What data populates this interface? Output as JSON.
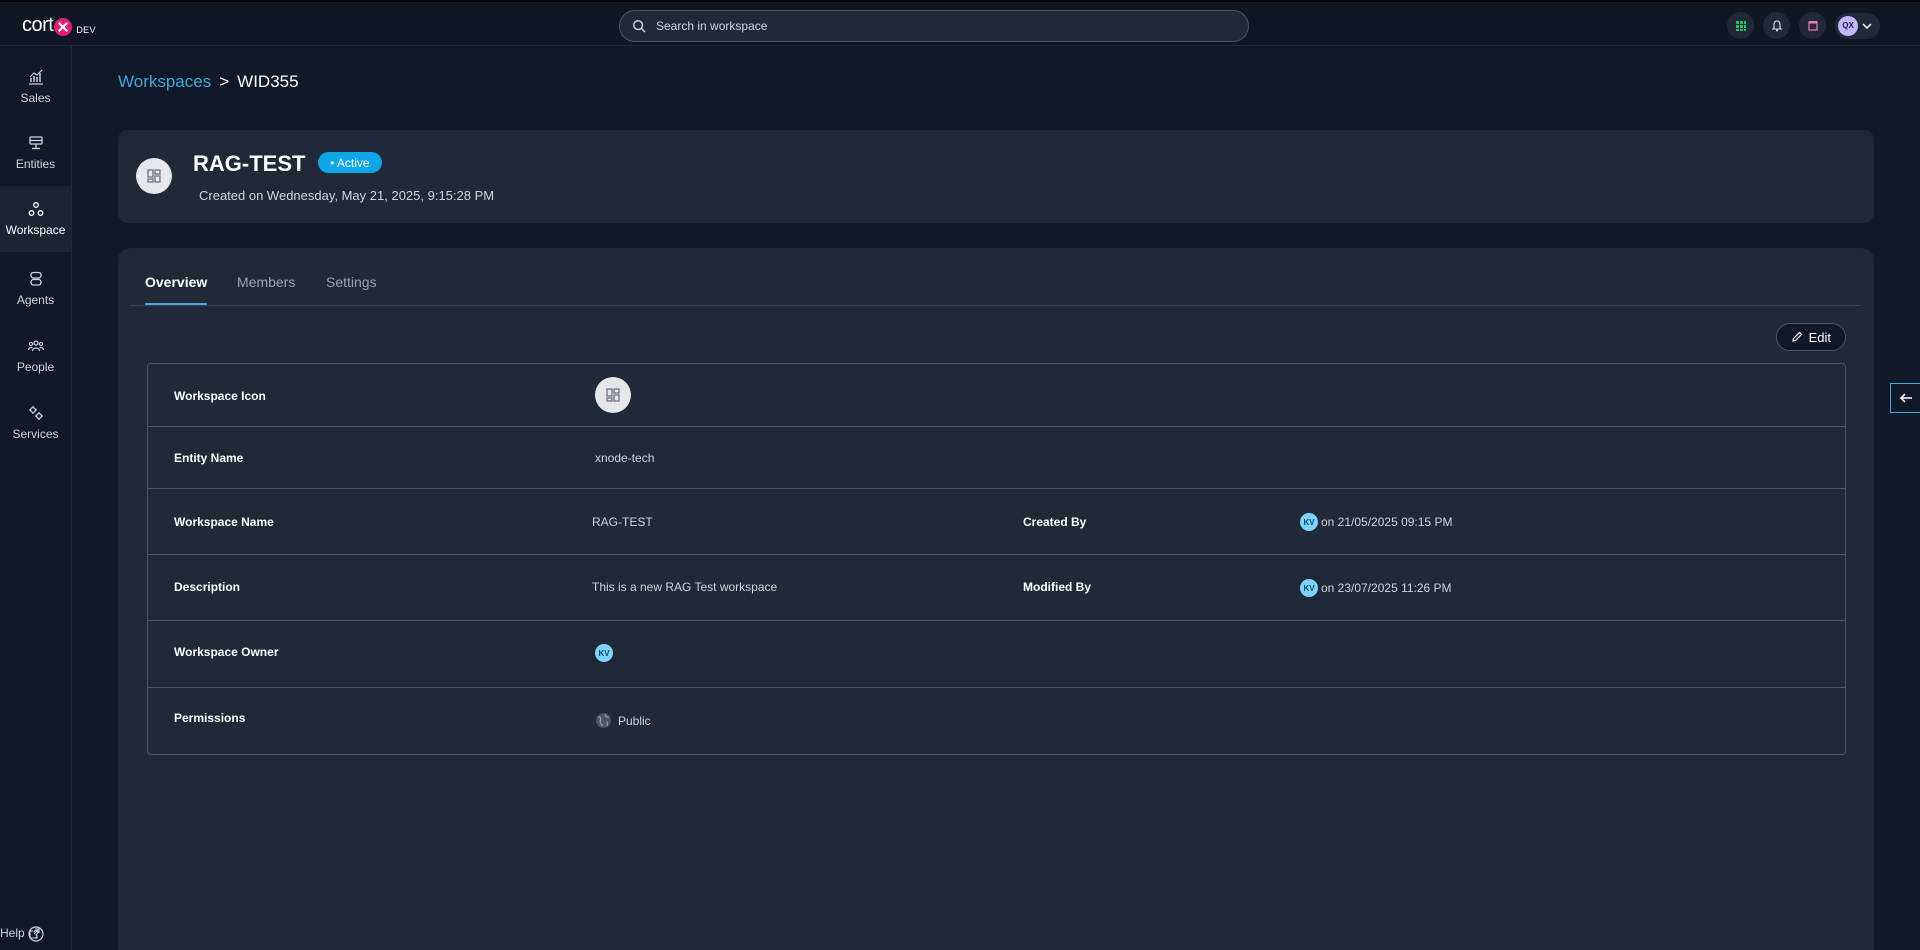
{
  "app": {
    "logo_text": "cort",
    "logo_suffix": "DEV"
  },
  "search": {
    "placeholder": "Search in workspace"
  },
  "user": {
    "initials": "QX"
  },
  "sidebar": {
    "items": [
      {
        "label": "Sales",
        "icon": "chart-icon"
      },
      {
        "label": "Entities",
        "icon": "entities-icon"
      },
      {
        "label": "Workspace",
        "icon": "workspace-icon",
        "active": true
      },
      {
        "label": "Agents",
        "icon": "agents-icon"
      },
      {
        "label": "People",
        "icon": "people-icon"
      },
      {
        "label": "Services",
        "icon": "gears-icon"
      }
    ],
    "help_label": "Help"
  },
  "breadcrumb": {
    "parent": "Workspaces",
    "separator": ">",
    "current": "WID355"
  },
  "workspace": {
    "title": "RAG-TEST",
    "status": "• Active",
    "created": "Created on Wednesday, May 21, 2025, 9:15:28 PM"
  },
  "tabs": [
    "Overview",
    "Members",
    "Settings"
  ],
  "edit_label": "Edit",
  "details": {
    "workspace_icon_label": "Workspace Icon",
    "entity_name_label": "Entity Name",
    "entity_name": "xnode-tech",
    "workspace_name_label": "Workspace Name",
    "workspace_name": "RAG-TEST",
    "created_by_label": "Created By",
    "created_by_initials": "KV",
    "created_by_text": "on 21/05/2025 09:15 PM",
    "description_label": "Description",
    "description": "This is a new RAG Test workspace",
    "modified_by_label": "Modified By",
    "modified_by_initials": "KV",
    "modified_by_text": "on 23/07/2025 11:26 PM",
    "owner_label": "Workspace Owner",
    "owner_initials": "KV",
    "permissions_label": "Permissions",
    "permissions_value": "Public"
  },
  "colors": {
    "accent": "#3ea8e0",
    "status": "#0ea5e9",
    "brand": "#e11d74"
  }
}
